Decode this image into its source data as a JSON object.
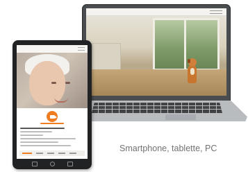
{
  "caption": "Smartphone, tablette, PC",
  "colors": {
    "accent_orange": "#ef7d21",
    "device_dark": "#202224",
    "caption_text": "#707274"
  },
  "icons": {
    "tablet_action": "video-camera-icon"
  }
}
